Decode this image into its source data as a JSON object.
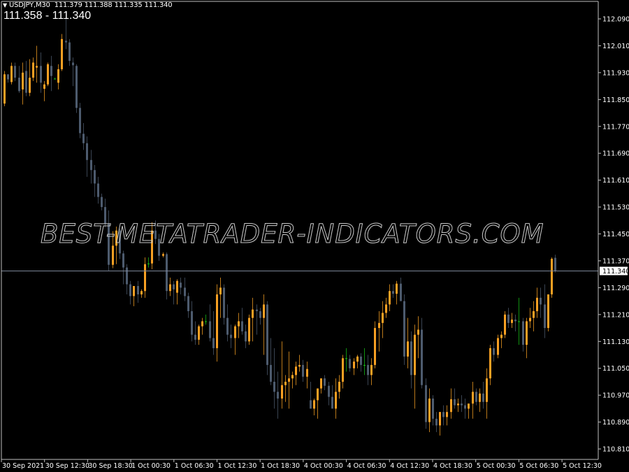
{
  "header": {
    "symbol": "USDJPY,M30",
    "ohlc": "111.379 111.388 111.335 111.340",
    "bid_ask": "111.358 - 111.340",
    "collapse_icon": "triangle-down-icon"
  },
  "watermark": "BEST-METATRADER-INDICATORS.COM",
  "colors": {
    "background": "#000000",
    "bull": "#f7a023",
    "bear": "#4d5b6e",
    "doji": "#16c016",
    "axis": "#c0c0c0",
    "price_line": "#7a8596",
    "text": "#ffffff"
  },
  "chart_data": {
    "type": "candlestick",
    "title": "USDJPY,M30",
    "current_price": 111.34,
    "current_price_label": "111.340",
    "ylim": [
      110.785,
      112.12
    ],
    "yticks": [
      "112.090",
      "112.010",
      "111.930",
      "111.850",
      "111.770",
      "111.690",
      "111.610",
      "111.530",
      "111.450",
      "111.370",
      "111.290",
      "111.210",
      "111.130",
      "111.050",
      "110.970",
      "110.890",
      "110.810"
    ],
    "xticks": [
      "30 Sep 2021",
      "30 Sep 12:30",
      "30 Sep 18:30",
      "1 Oct 00:30",
      "1 Oct 06:30",
      "1 Oct 12:30",
      "1 Oct 18:30",
      "4 Oct 00:30",
      "4 Oct 06:30",
      "4 Oct 12:30",
      "4 Oct 18:30",
      "5 Oct 00:30",
      "5 Oct 06:30",
      "5 Oct 12:30"
    ],
    "grid": false,
    "candles": [
      [
        111.838,
        111.935,
        111.83,
        111.925
      ],
      [
        111.925,
        111.925,
        111.9,
        111.91
      ],
      [
        111.902,
        111.96,
        111.895,
        111.95
      ],
      [
        111.95,
        111.96,
        111.905,
        111.915
      ],
      [
        111.915,
        111.95,
        111.87,
        111.875
      ],
      [
        111.88,
        111.96,
        111.835,
        111.93
      ],
      [
        111.935,
        111.965,
        111.86,
        111.87
      ],
      [
        111.87,
        111.97,
        111.86,
        111.915
      ],
      [
        111.915,
        111.975,
        111.905,
        111.96
      ],
      [
        111.945,
        112.01,
        111.9,
        111.95
      ],
      [
        111.95,
        111.99,
        111.87,
        111.9
      ],
      [
        111.882,
        111.905,
        111.845,
        111.895
      ],
      [
        111.895,
        111.96,
        111.89,
        111.955
      ],
      [
        111.95,
        111.98,
        111.875,
        111.92
      ],
      [
        111.91,
        111.915,
        111.91,
        111.912
      ],
      [
        111.9,
        111.955,
        111.88,
        111.94
      ],
      [
        111.94,
        112.045,
        111.935,
        112.03
      ],
      [
        112.025,
        112.09,
        112.0,
        112.02
      ],
      [
        112.02,
        112.03,
        111.95,
        111.965
      ],
      [
        111.96,
        111.975,
        111.89,
        111.952
      ],
      [
        111.95,
        111.955,
        111.81,
        111.825
      ],
      [
        111.825,
        111.84,
        111.735,
        111.75
      ],
      [
        111.748,
        111.78,
        111.7,
        111.72
      ],
      [
        111.72,
        111.74,
        111.62,
        111.67
      ],
      [
        111.67,
        111.7,
        111.6,
        111.64
      ],
      [
        111.64,
        111.655,
        111.56,
        111.6
      ],
      [
        111.6,
        111.62,
        111.54,
        111.56
      ],
      [
        111.56,
        111.57,
        111.52,
        111.53
      ],
      [
        111.53,
        111.555,
        111.47,
        111.48
      ],
      [
        111.48,
        111.52,
        111.34,
        111.358
      ],
      [
        111.358,
        111.458,
        111.348,
        111.415
      ],
      [
        111.415,
        111.472,
        111.36,
        111.46
      ],
      [
        111.46,
        111.465,
        111.375,
        111.392
      ],
      [
        111.392,
        111.4,
        111.3,
        111.35
      ],
      [
        111.35,
        111.36,
        111.27,
        111.3
      ],
      [
        111.3,
        111.31,
        111.24,
        111.265
      ],
      [
        111.265,
        111.29,
        111.235,
        111.295
      ],
      [
        111.295,
        111.31,
        111.245,
        111.27
      ],
      [
        111.27,
        111.285,
        111.26,
        111.28
      ],
      [
        111.28,
        111.38,
        111.26,
        111.36
      ],
      [
        111.36,
        111.38,
        111.35,
        111.362
      ],
      [
        111.362,
        111.485,
        111.345,
        111.46
      ],
      [
        111.46,
        111.49,
        111.42,
        111.435
      ],
      [
        111.435,
        111.45,
        111.37,
        111.385
      ],
      [
        111.385,
        111.395,
        111.38,
        111.39
      ],
      [
        111.39,
        111.395,
        111.255,
        111.28
      ],
      [
        111.28,
        111.32,
        111.265,
        111.3
      ],
      [
        111.3,
        111.31,
        111.24,
        111.285
      ],
      [
        111.275,
        111.315,
        111.24,
        111.31
      ],
      [
        111.305,
        111.32,
        111.27,
        111.29
      ],
      [
        111.29,
        111.32,
        111.25,
        111.265
      ],
      [
        111.265,
        111.275,
        111.2,
        111.22
      ],
      [
        111.22,
        111.25,
        111.13,
        111.15
      ],
      [
        111.15,
        111.19,
        111.12,
        111.135
      ],
      [
        111.135,
        111.18,
        111.12,
        111.175
      ],
      [
        111.175,
        111.2,
        111.15,
        111.19
      ],
      [
        111.19,
        111.21,
        111.18,
        111.188
      ],
      [
        111.19,
        111.24,
        111.13,
        111.14
      ],
      [
        111.14,
        111.22,
        111.09,
        111.11
      ],
      [
        111.11,
        111.3,
        111.07,
        111.27
      ],
      [
        111.27,
        111.32,
        111.2,
        111.29
      ],
      [
        111.29,
        111.3,
        111.18,
        111.2
      ],
      [
        111.2,
        111.24,
        111.13,
        111.15
      ],
      [
        111.15,
        111.18,
        111.11,
        111.14
      ],
      [
        111.14,
        111.18,
        111.09,
        111.175
      ],
      [
        111.175,
        111.215,
        111.14,
        111.19
      ],
      [
        111.19,
        111.23,
        111.15,
        111.16
      ],
      [
        111.16,
        111.18,
        111.11,
        111.13
      ],
      [
        111.13,
        111.21,
        111.12,
        111.2
      ],
      [
        111.2,
        111.26,
        111.13,
        111.225
      ],
      [
        111.225,
        111.24,
        111.15,
        111.22
      ],
      [
        111.22,
        111.23,
        111.18,
        111.2
      ],
      [
        111.2,
        111.27,
        111.09,
        111.24
      ],
      [
        111.24,
        111.25,
        111.03,
        111.06
      ],
      [
        111.06,
        111.14,
        111.0,
        111.01
      ],
      [
        111.01,
        111.11,
        110.93,
        110.98
      ],
      [
        110.98,
        111.04,
        110.9,
        110.96
      ],
      [
        110.96,
        111.13,
        110.93,
        111.0
      ],
      [
        111.0,
        111.03,
        110.95,
        111.01
      ],
      [
        111.01,
        111.1,
        110.93,
        111.02
      ],
      [
        111.02,
        111.04,
        110.99,
        111.03
      ],
      [
        111.03,
        111.07,
        111.0,
        111.055
      ],
      [
        111.055,
        111.09,
        111.04,
        111.06
      ],
      [
        111.06,
        111.075,
        111.01,
        111.025
      ],
      [
        111.025,
        111.07,
        110.99,
        111.048
      ],
      [
        110.955,
        111.01,
        110.93,
        110.93
      ],
      [
        110.93,
        110.96,
        110.91,
        110.955
      ],
      [
        110.955,
        110.99,
        110.9,
        110.99
      ],
      [
        110.99,
        111.02,
        110.975,
        111.02
      ],
      [
        111.02,
        111.03,
        110.985,
        110.998
      ],
      [
        110.998,
        111.01,
        110.94,
        110.965
      ],
      [
        110.965,
        111.0,
        110.94,
        110.93
      ],
      [
        110.93,
        111.02,
        110.9,
        110.98
      ],
      [
        110.98,
        111.03,
        110.96,
        111.01
      ],
      [
        111.01,
        111.09,
        110.99,
        111.08
      ],
      [
        111.08,
        111.11,
        111.04,
        111.078
      ],
      [
        111.078,
        111.09,
        111.04,
        111.05
      ],
      [
        111.05,
        111.08,
        111.03,
        111.07
      ],
      [
        111.07,
        111.09,
        111.05,
        111.085
      ],
      [
        111.085,
        111.095,
        111.04,
        111.06
      ],
      [
        111.06,
        111.11,
        111.03,
        111.06
      ],
      [
        111.06,
        111.09,
        111.0,
        111.03
      ],
      [
        111.03,
        111.08,
        111.0,
        111.06
      ],
      [
        111.06,
        111.19,
        111.05,
        111.17
      ],
      [
        111.17,
        111.22,
        111.1,
        111.185
      ],
      [
        111.185,
        111.25,
        111.14,
        111.215
      ],
      [
        111.215,
        111.26,
        111.2,
        111.24
      ],
      [
        111.24,
        111.3,
        111.22,
        111.28
      ],
      [
        111.28,
        111.3,
        111.26,
        111.272
      ],
      [
        111.272,
        111.31,
        111.24,
        111.302
      ],
      [
        111.302,
        111.32,
        111.26,
        111.25
      ],
      [
        111.25,
        111.27,
        111.06,
        111.085
      ],
      [
        111.085,
        111.2,
        111.05,
        111.13
      ],
      [
        111.13,
        111.16,
        110.99,
        111.03
      ],
      [
        111.03,
        111.18,
        110.93,
        111.15
      ],
      [
        111.15,
        111.205,
        111.08,
        111.165
      ],
      [
        111.165,
        111.2,
        110.99,
        111.0
      ],
      [
        111.0,
        111.02,
        110.87,
        110.89
      ],
      [
        110.89,
        110.99,
        110.86,
        110.96
      ],
      [
        110.96,
        110.97,
        110.88,
        110.9
      ],
      [
        110.9,
        110.92,
        110.86,
        110.88
      ],
      [
        110.88,
        110.92,
        110.85,
        110.92
      ],
      [
        110.92,
        110.94,
        110.88,
        110.905
      ],
      [
        110.905,
        110.94,
        110.88,
        110.92
      ],
      [
        110.92,
        110.99,
        110.9,
        110.958
      ],
      [
        110.958,
        110.99,
        110.93,
        110.94
      ],
      [
        110.94,
        110.96,
        110.92,
        110.945
      ],
      [
        110.945,
        110.97,
        110.92,
        110.94
      ],
      [
        110.94,
        110.96,
        110.9,
        110.93
      ],
      [
        110.93,
        110.945,
        110.9,
        110.945
      ],
      [
        110.945,
        111.01,
        110.9,
        110.98
      ],
      [
        110.98,
        110.99,
        110.94,
        110.95
      ],
      [
        110.95,
        110.99,
        110.92,
        110.975
      ],
      [
        110.975,
        111.01,
        110.93,
        110.95
      ],
      [
        110.95,
        111.05,
        110.9,
        111.02
      ],
      [
        111.02,
        111.12,
        111.0,
        111.11
      ],
      [
        111.11,
        111.13,
        111.07,
        111.09
      ],
      [
        111.09,
        111.15,
        111.08,
        111.14
      ],
      [
        111.14,
        111.16,
        111.11,
        111.15
      ],
      [
        111.15,
        111.22,
        111.14,
        111.21
      ],
      [
        111.21,
        111.23,
        111.17,
        111.185
      ],
      [
        111.185,
        111.215,
        111.17,
        111.195
      ],
      [
        111.195,
        111.21,
        111.16,
        111.19
      ],
      [
        111.19,
        111.26,
        111.12,
        111.19
      ],
      [
        111.19,
        111.2,
        111.1,
        111.12
      ],
      [
        111.12,
        111.2,
        111.08,
        111.19
      ],
      [
        111.19,
        111.23,
        111.17,
        111.2
      ],
      [
        111.2,
        111.25,
        111.16,
        111.22
      ],
      [
        111.22,
        111.29,
        111.2,
        111.26
      ],
      [
        111.26,
        111.29,
        111.2,
        111.24
      ],
      [
        111.24,
        111.3,
        111.14,
        111.17
      ],
      [
        111.17,
        111.27,
        111.16,
        111.27
      ],
      [
        111.27,
        111.38,
        111.26,
        111.376
      ],
      [
        111.379,
        111.388,
        111.335,
        111.34
      ]
    ]
  }
}
